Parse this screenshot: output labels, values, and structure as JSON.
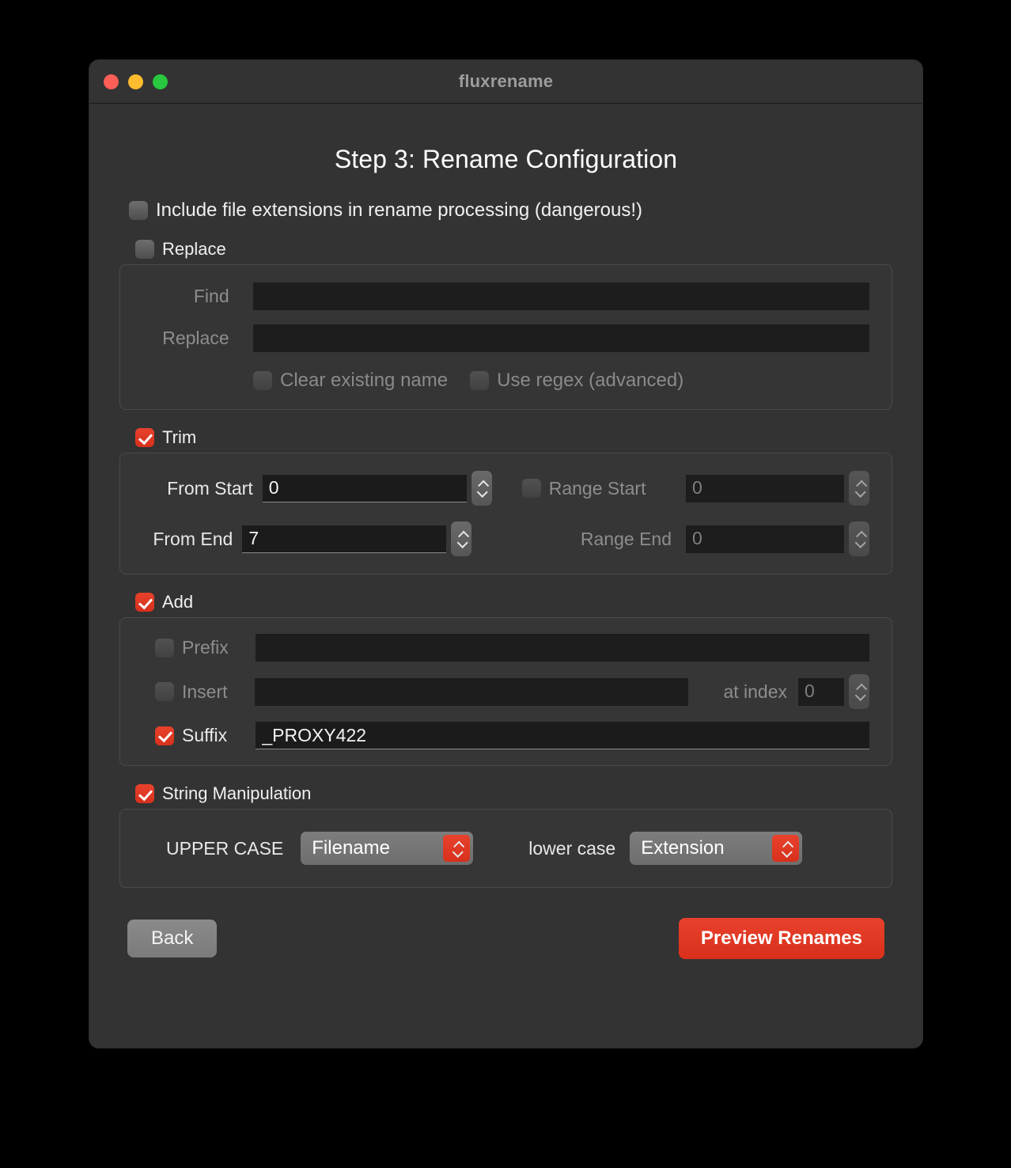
{
  "window": {
    "title": "fluxrename",
    "traffic_lights": [
      {
        "name": "close",
        "color": "#ff5f56"
      },
      {
        "name": "minimize",
        "color": "#febc2e"
      },
      {
        "name": "maximize",
        "color": "#28c840"
      }
    ]
  },
  "page": {
    "title": "Step 3: Rename Configuration"
  },
  "include_extensions": {
    "label": "Include file extensions in rename processing (dangerous!)",
    "checked": false
  },
  "replace": {
    "group_label": "Replace",
    "checked": false,
    "enabled": false,
    "find_label": "Find",
    "find_value": "",
    "replace_label": "Replace",
    "replace_value": "",
    "clear_existing_label": "Clear existing name",
    "clear_existing_checked": false,
    "use_regex_label": "Use regex (advanced)",
    "use_regex_checked": false
  },
  "trim": {
    "group_label": "Trim",
    "checked": true,
    "from_start_label": "From Start",
    "from_start_value": "0",
    "from_end_label": "From End",
    "from_end_value": "7",
    "range_start_label": "Range Start",
    "range_start_checked": false,
    "range_start_value": "0",
    "range_end_label": "Range End",
    "range_end_value": "0"
  },
  "add": {
    "group_label": "Add",
    "checked": true,
    "prefix_label": "Prefix",
    "prefix_checked": false,
    "prefix_value": "",
    "insert_label": "Insert",
    "insert_checked": false,
    "insert_value": "",
    "at_index_label": "at index",
    "at_index_value": "0",
    "suffix_label": "Suffix",
    "suffix_checked": true,
    "suffix_value": "_PROXY422"
  },
  "string_manipulation": {
    "group_label": "String Manipulation",
    "checked": true,
    "upper_case_label": "UPPER CASE",
    "upper_case_target": "Filename",
    "lower_case_label": "lower case",
    "lower_case_target": "Extension"
  },
  "footer": {
    "back_label": "Back",
    "preview_label": "Preview Renames"
  },
  "colors": {
    "accent_red": "#e8412c",
    "window_bg": "#333333",
    "group_bg": "#363636",
    "field_bg": "#1b1b1b"
  }
}
